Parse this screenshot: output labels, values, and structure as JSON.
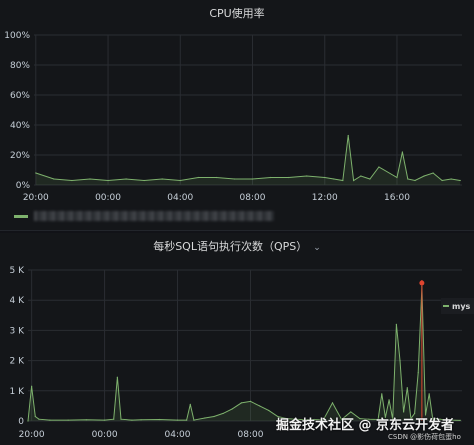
{
  "panels": [
    {
      "title": "CPU使用率",
      "legend_label": "",
      "chart_data": {
        "type": "line",
        "title": "CPU使用率",
        "y_ticks": [
          "0%",
          "20%",
          "40%",
          "60%",
          "80%",
          "100%"
        ],
        "ylim": [
          0,
          100
        ],
        "x_ticks": [
          "20:00",
          "00:00",
          "04:00",
          "08:00",
          "12:00",
          "16:00"
        ],
        "xlim_hours": [
          19.9,
          43.6
        ],
        "grid": true,
        "series": [
          {
            "color": "#7eb26d",
            "x_hours": [
              20,
              21,
              22,
              23,
              24,
              25,
              26,
              27,
              28,
              29,
              30,
              31,
              32,
              33,
              34,
              35,
              36,
              36.5,
              37,
              37.3,
              37.6,
              38,
              38.5,
              39,
              40,
              40.3,
              40.6,
              41,
              41.5,
              42,
              42.5,
              43,
              43.5
            ],
            "values": [
              8,
              4,
              3,
              4,
              3,
              4,
              3,
              4,
              3,
              5,
              5,
              4,
              4,
              5,
              5,
              6,
              5,
              4,
              3,
              33,
              3,
              6,
              4,
              12,
              5,
              22,
              4,
              3,
              6,
              8,
              3,
              4,
              3
            ]
          }
        ]
      }
    },
    {
      "title": "每秒SQL语句执行次数（QPS）",
      "legend_label": "mys",
      "chart_data": {
        "type": "line",
        "title": "每秒SQL语句执行次数（QPS）",
        "y_ticks": [
          "0",
          "1 K",
          "2 K",
          "3 K",
          "4 K",
          "5 K"
        ],
        "ylim": [
          0,
          5000
        ],
        "x_ticks": [
          "20:00",
          "00:00",
          "04:00",
          "08:00"
        ],
        "xlim_hours": [
          19.8,
          43.6
        ],
        "grid": true,
        "series": [
          {
            "name": "mys",
            "color": "#7eb26d",
            "x_hours": [
              19.8,
              20.0,
              20.2,
              20.4,
              21,
              22,
              23,
              24,
              24.5,
              24.7,
              24.9,
              25.5,
              26,
              27,
              28,
              28.5,
              28.7,
              28.9,
              29.5,
              30,
              30.5,
              31,
              31.5,
              32,
              32.5,
              33,
              33.5,
              34,
              34.5,
              35,
              35.5,
              36,
              36.5,
              37,
              37.5,
              38,
              38.5,
              39,
              39.2,
              39.4,
              39.6,
              39.8,
              40,
              40.2,
              40.4,
              40.6,
              40.8,
              41,
              41.2,
              41.4,
              41.6,
              41.8,
              42,
              42.2,
              42.4,
              42.6,
              43,
              43.5
            ],
            "values": [
              0,
              1150,
              150,
              60,
              30,
              30,
              40,
              30,
              60,
              1450,
              60,
              30,
              40,
              50,
              30,
              30,
              550,
              30,
              100,
              150,
              250,
              400,
              600,
              650,
              500,
              350,
              150,
              80,
              60,
              40,
              50,
              40,
              600,
              50,
              300,
              80,
              60,
              50,
              900,
              120,
              700,
              60,
              3200,
              2000,
              300,
              1100,
              80,
              250,
              1600,
              4450,
              200,
              900,
              50,
              80,
              60,
              40,
              30,
              20
            ]
          }
        ],
        "annotation": {
          "x_hours": 41.4,
          "color": "#e0452f"
        }
      }
    }
  ],
  "watermark": {
    "main": "掘金技术社区 @ 京东云开发者",
    "sub": "CSDN @影伤荷包蛋ho"
  }
}
